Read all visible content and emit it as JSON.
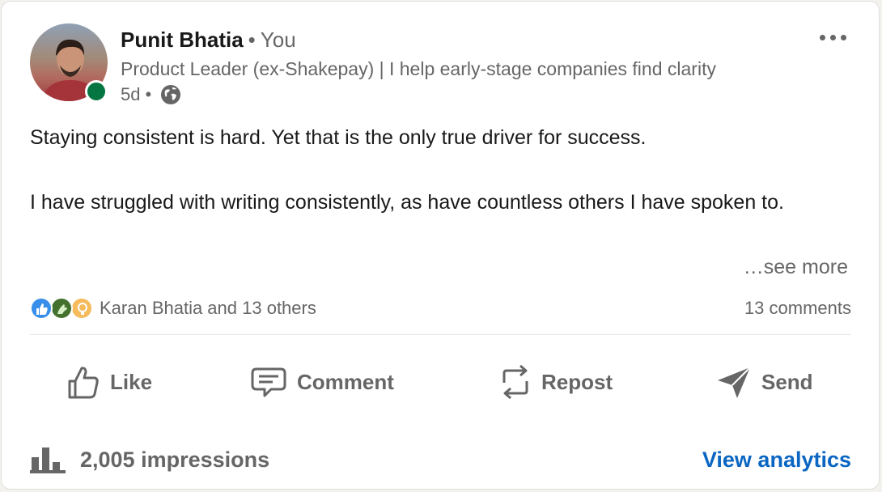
{
  "post": {
    "author": {
      "name": "Punit Bhatia",
      "separator": "•",
      "relation": "You",
      "headline": "Product Leader (ex-Shakepay) | I help early-stage companies find clarity",
      "timestamp": "5d",
      "timestamp_separator": "•",
      "visibility_icon": "globe-icon",
      "online_status_color": "#057642"
    },
    "more_icon": "ellipsis-icon",
    "body_paragraphs": [
      "Staying consistent is hard. Yet that is the only true driver for success.",
      "I have struggled with writing consistently, as have countless others I have spoken to."
    ],
    "see_more": "…see more",
    "reactions": {
      "icons": [
        "like-reaction-icon",
        "celebrate-reaction-icon",
        "insightful-reaction-icon"
      ],
      "summary": "Karan Bhatia and 13 others",
      "comments": "13 comments"
    },
    "actions": {
      "like": "Like",
      "comment": "Comment",
      "repost": "Repost",
      "send": "Send"
    },
    "footer": {
      "impressions": "2,005 impressions",
      "analytics_link": "View analytics"
    },
    "colors": {
      "link": "#0a66c2",
      "muted": "#666666",
      "text": "#191919"
    }
  }
}
